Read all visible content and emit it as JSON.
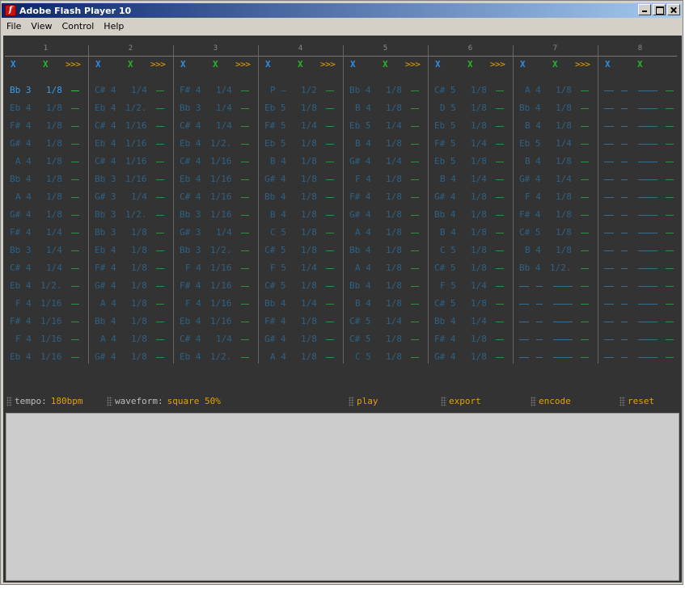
{
  "window": {
    "title": "Adobe Flash Player 10",
    "icon_glyph": "f"
  },
  "menu": [
    {
      "label": "File"
    },
    {
      "label": "View"
    },
    {
      "label": "Control"
    },
    {
      "label": "Help"
    }
  ],
  "channels": [
    {
      "number": "1",
      "notes": [
        [
          "Bb 3",
          "1/8"
        ],
        [
          "Eb 4",
          "1/8"
        ],
        [
          "F# 4",
          "1/8"
        ],
        [
          "G# 4",
          "1/8"
        ],
        [
          "A 4",
          "1/8"
        ],
        [
          "Bb 4",
          "1/8"
        ],
        [
          "A 4",
          "1/8"
        ],
        [
          "G# 4",
          "1/8"
        ],
        [
          "F# 4",
          "1/4"
        ],
        [
          "Bb 3",
          "1/4"
        ],
        [
          "C# 4",
          "1/4"
        ],
        [
          "Eb 4",
          "1/2."
        ],
        [
          "F 4",
          "1/16"
        ],
        [
          "F# 4",
          "1/16"
        ],
        [
          "F 4",
          "1/16"
        ],
        [
          "Eb 4",
          "1/16"
        ]
      ]
    },
    {
      "number": "2",
      "notes": [
        [
          "C# 4",
          "1/4"
        ],
        [
          "Eb 4",
          "1/2."
        ],
        [
          "C# 4",
          "1/16"
        ],
        [
          "Eb 4",
          "1/16"
        ],
        [
          "C# 4",
          "1/16"
        ],
        [
          "Bb 3",
          "1/16"
        ],
        [
          "G# 3",
          "1/4"
        ],
        [
          "Bb 3",
          "1/2."
        ],
        [
          "Bb 3",
          "1/8"
        ],
        [
          "Eb 4",
          "1/8"
        ],
        [
          "F# 4",
          "1/8"
        ],
        [
          "G# 4",
          "1/8"
        ],
        [
          "A 4",
          "1/8"
        ],
        [
          "Bb 4",
          "1/8"
        ],
        [
          "A 4",
          "1/8"
        ],
        [
          "G# 4",
          "1/8"
        ]
      ]
    },
    {
      "number": "3",
      "notes": [
        [
          "F# 4",
          "1/4"
        ],
        [
          "Bb 3",
          "1/4"
        ],
        [
          "C# 4",
          "1/4"
        ],
        [
          "Eb 4",
          "1/2."
        ],
        [
          "C# 4",
          "1/16"
        ],
        [
          "Eb 4",
          "1/16"
        ],
        [
          "C# 4",
          "1/16"
        ],
        [
          "Bb 3",
          "1/16"
        ],
        [
          "G# 3",
          "1/4"
        ],
        [
          "Bb 3",
          "1/2."
        ],
        [
          "F 4",
          "1/16"
        ],
        [
          "F# 4",
          "1/16"
        ],
        [
          "F 4",
          "1/16"
        ],
        [
          "Eb 4",
          "1/16"
        ],
        [
          "C# 4",
          "1/4"
        ],
        [
          "Eb 4",
          "1/2."
        ]
      ]
    },
    {
      "number": "4",
      "notes": [
        [
          "P —",
          "1/2"
        ],
        [
          "Eb 5",
          "1/8"
        ],
        [
          "F# 5",
          "1/4"
        ],
        [
          "Eb 5",
          "1/8"
        ],
        [
          "B 4",
          "1/8"
        ],
        [
          "G# 4",
          "1/8"
        ],
        [
          "Bb 4",
          "1/8"
        ],
        [
          "B 4",
          "1/8"
        ],
        [
          "C 5",
          "1/8"
        ],
        [
          "C# 5",
          "1/8"
        ],
        [
          "F 5",
          "1/4"
        ],
        [
          "C# 5",
          "1/8"
        ],
        [
          "Bb 4",
          "1/4"
        ],
        [
          "F# 4",
          "1/8"
        ],
        [
          "G# 4",
          "1/8"
        ],
        [
          "A 4",
          "1/8"
        ]
      ]
    },
    {
      "number": "5",
      "notes": [
        [
          "Bb 4",
          "1/8"
        ],
        [
          "B 4",
          "1/8"
        ],
        [
          "Eb 5",
          "1/4"
        ],
        [
          "B 4",
          "1/8"
        ],
        [
          "G# 4",
          "1/4"
        ],
        [
          "F 4",
          "1/8"
        ],
        [
          "F# 4",
          "1/8"
        ],
        [
          "G# 4",
          "1/8"
        ],
        [
          "A 4",
          "1/8"
        ],
        [
          "Bb 4",
          "1/8"
        ],
        [
          "A 4",
          "1/8"
        ],
        [
          "Bb 4",
          "1/8"
        ],
        [
          "B 4",
          "1/8"
        ],
        [
          "C# 5",
          "1/4"
        ],
        [
          "C# 5",
          "1/8"
        ],
        [
          "C 5",
          "1/8"
        ]
      ]
    },
    {
      "number": "6",
      "notes": [
        [
          "C# 5",
          "1/8"
        ],
        [
          "D 5",
          "1/8"
        ],
        [
          "Eb 5",
          "1/8"
        ],
        [
          "F# 5",
          "1/4"
        ],
        [
          "Eb 5",
          "1/8"
        ],
        [
          "B 4",
          "1/4"
        ],
        [
          "G# 4",
          "1/8"
        ],
        [
          "Bb 4",
          "1/8"
        ],
        [
          "B 4",
          "1/8"
        ],
        [
          "C 5",
          "1/8"
        ],
        [
          "C# 5",
          "1/8"
        ],
        [
          "F 5",
          "1/4"
        ],
        [
          "C# 5",
          "1/8"
        ],
        [
          "Bb 4",
          "1/4"
        ],
        [
          "F# 4",
          "1/8"
        ],
        [
          "G# 4",
          "1/8"
        ]
      ]
    },
    {
      "number": "7",
      "notes": [
        [
          "A 4",
          "1/8"
        ],
        [
          "Bb 4",
          "1/8"
        ],
        [
          "B 4",
          "1/8"
        ],
        [
          "Eb 5",
          "1/4"
        ],
        [
          "B 4",
          "1/8"
        ],
        [
          "G# 4",
          "1/4"
        ],
        [
          "F 4",
          "1/8"
        ],
        [
          "F# 4",
          "1/8"
        ],
        [
          "C# 5",
          "1/8"
        ],
        [
          "B 4",
          "1/8"
        ],
        [
          "Bb 4",
          "1/2."
        ],
        null,
        null,
        null,
        null,
        null
      ]
    },
    {
      "number": "8",
      "notes": [
        null,
        null,
        null,
        null,
        null,
        null,
        null,
        null,
        null,
        null,
        null,
        null,
        null,
        null,
        null,
        null
      ]
    }
  ],
  "controls": {
    "mute": "X",
    "solo": "X",
    "forward": ">>>"
  },
  "bottom": {
    "tempo_label": "tempo:",
    "tempo_value": "180bpm",
    "waveform_label": "waveform:",
    "waveform_value": "square 50%",
    "play": "play",
    "export": "export",
    "encode": "encode",
    "reset": "reset"
  },
  "colors": {
    "accent": "#e6a000",
    "mute": "#2f8ee0",
    "solo": "#2bb32b",
    "note": "#2e6184",
    "note_active": "#3c9ce8",
    "stage": "#333333"
  },
  "active_cell": {
    "channel": 0,
    "row": 0
  }
}
